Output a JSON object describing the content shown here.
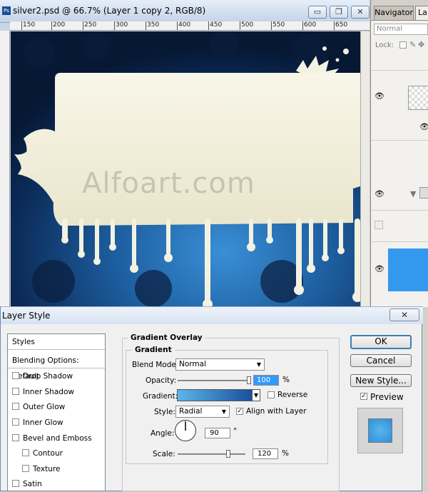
{
  "document": {
    "title": "silver2.psd @ 66.7% (Layer 1 copy 2, RGB/8)",
    "ps_icon": "Ps",
    "ruler_ticks": [
      "150",
      "200",
      "250",
      "300",
      "350",
      "400",
      "450",
      "500",
      "550",
      "600",
      "650"
    ],
    "watermark": "Alfoart.com",
    "min_glyph": "▭",
    "restore_glyph": "❐",
    "close_glyph": "✕"
  },
  "panel": {
    "tab_navigator": "Navigator",
    "tab_layers": "La",
    "blend_mode": "Normal",
    "lock_label": "Lock:",
    "eye_glyph": "👁",
    "fold_glyph": "▼"
  },
  "dialog": {
    "title": "Layer Style",
    "close_glyph": "✕",
    "styles_list": [
      {
        "label": "Styles",
        "checkbox": false
      },
      {
        "label": "Blending Options: Default",
        "checkbox": false
      },
      {
        "label": "Drop Shadow",
        "checkbox": true
      },
      {
        "label": "Inner Shadow",
        "checkbox": true
      },
      {
        "label": "Outer Glow",
        "checkbox": true
      },
      {
        "label": "Inner Glow",
        "checkbox": true
      },
      {
        "label": "Bevel and Emboss",
        "checkbox": true
      },
      {
        "label": "Contour",
        "checkbox": true
      },
      {
        "label": "Texture",
        "checkbox": true
      },
      {
        "label": "Satin",
        "checkbox": true
      }
    ],
    "section_title": "Gradient Overlay",
    "group_title": "Gradient",
    "blend_mode_label": "Blend Mode:",
    "blend_mode_value": "Normal",
    "opacity_label": "Opacity:",
    "opacity_value": "100",
    "opacity_fraction": 1.0,
    "percent": "%",
    "gradient_label": "Gradient:",
    "reverse_label": "Reverse",
    "reverse_checked": false,
    "style_label": "Style:",
    "style_value": "Radial",
    "align_label": "Align with Layer",
    "align_checked": true,
    "angle_label": "Angle:",
    "angle_value": "90",
    "degree": "°",
    "scale_label": "Scale:",
    "scale_value": "120",
    "scale_fraction": 0.75,
    "ok_label": "OK",
    "cancel_label": "Cancel",
    "new_style_label": "New Style...",
    "preview_label": "Preview",
    "preview_checked": true,
    "check_glyph": "✓",
    "arrow_glyph": "▼"
  },
  "colors": {
    "gradient_start": "#5ab6ea",
    "gradient_end": "#1b4f9c",
    "preview_swatch": "#2f8fdc",
    "layer_thumb_blue": "#3399ee",
    "cream": "#f3f1df"
  }
}
